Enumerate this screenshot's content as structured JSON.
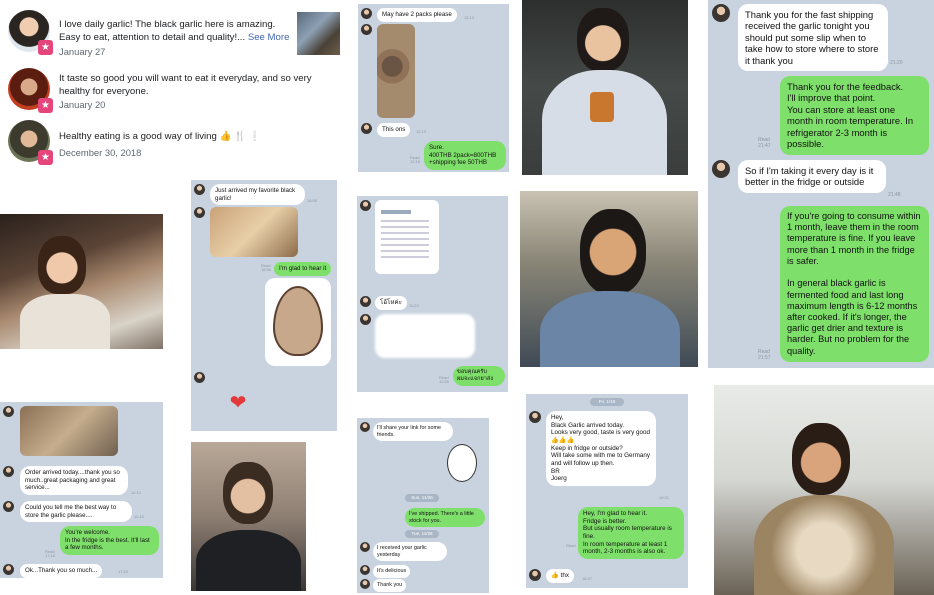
{
  "reviews": [
    {
      "text": "I love daily garlic! The black garlic here is amazing. Easy to eat, attention to detail and quality!...",
      "see_more": "See More",
      "date": "January 27"
    },
    {
      "text": "It taste so good you will want to eat it everyday, and so very healthy for everyone.",
      "date": "January 20"
    },
    {
      "text": "Healthy eating is a good way of living 👍 🍴 ❕",
      "date": "December 30, 2018"
    }
  ],
  "chat_store": {
    "messages": [
      {
        "text": "Thank you for the fast shipping received the garlic tonight you should put some slip when to take how to store where to store it thank you",
        "time": "21:20"
      },
      {
        "text": "Thank you for the feedback.\nI'll improve that point.\nYou can store at least one month in room temperature. In refrigerator 2-3 month is possible.",
        "status": "Read\n21:47"
      },
      {
        "text": "So if I'm taking it every day is it better in the fridge or outside",
        "time": "21:48"
      },
      {
        "text": "If you're going to consume within 1 month, leave them in the room temperature is fine. If you leave more than 1 month in the fridge is safer.\n\nIn general black garlic is fermented food and last long maximum length is 6-12 months after cooked. If it's longer, the garlic get drier and texture is harder. But no problem for the quality.",
        "status": "Read\n21:57"
      }
    ]
  },
  "chat_joerg": {
    "date": "Fri, 1/16",
    "messages": [
      {
        "text": "Hey,\nBlack Garlic arrived today.\nLooks very good, taste is very good 👍👍👍\nKeep in fridge or outside?\nWill take some with me to Germany and will follow up then.\nBR\nJoerg",
        "time": "16:31"
      },
      {
        "text": "Hey, I'm glad to hear it.\nFridge is better.\nBut usually room temperature is fine.\nIn room temperature at least 1 month, 2-3 months is also ok.",
        "status": "Read"
      },
      {
        "text": "👍 thx",
        "time": "16:37"
      }
    ]
  },
  "chat_share": {
    "date1": "Sun, 11/26",
    "date2": "Tue, 11/28",
    "messages": [
      {
        "text": "I'll share your link for some friends."
      },
      {
        "text": "I've shipped. There's a little stock for you."
      },
      {
        "text": "I received your garlic yesterday"
      },
      {
        "text": "It's delicious"
      },
      {
        "text": "Thank you"
      }
    ]
  },
  "chat_order": {
    "messages": [
      {
        "text": "Order arrived today....thank you so much..great packaging and great service...",
        "time": "11:13"
      },
      {
        "text": "Could you tell me the best way to store the garlic please....",
        "time": "11:13"
      },
      {
        "text": "You're welcome.\nIn the fridge is the best. It'll last a few months.",
        "status": "Read\n17:18"
      },
      {
        "text": "Ok...Thank you so much...",
        "time": "17:20"
      }
    ]
  },
  "chat_arrived": {
    "messages": [
      {
        "text": "Just arrived my favorite black garlic!",
        "time": "18:55"
      },
      {
        "text": "I'm glad to hear it",
        "status": "Read\n18:56"
      }
    ]
  },
  "chat_packs": {
    "messages": [
      {
        "text": "May have 2 packs please",
        "time": "12:13"
      },
      {
        "text": "This ons",
        "time": "12:13"
      },
      {
        "text": "Sure.\n400THB 2pack=800THB\n+shipping  fee 50THB",
        "status": "Read\n12:16"
      }
    ]
  },
  "chat_thai": {
    "messages": [
      {
        "text": "โอ้โหค่ะ",
        "time": "11:23"
      },
      {
        "text": "ขอบคุณครับ\nผมจะแจกยาส่ง",
        "status": "Read\n11:28"
      }
    ]
  },
  "colors": {
    "green_bubble": "#7ee06a",
    "chat_bg": "#c9d3e0",
    "badge": "#e5457a",
    "link": "#4267b2"
  }
}
